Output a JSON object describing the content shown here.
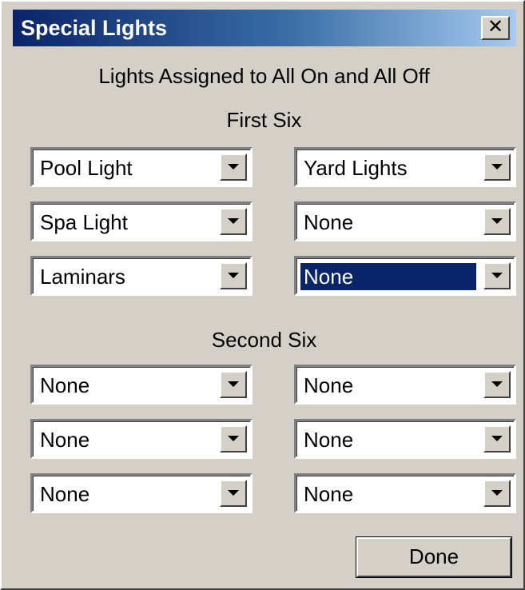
{
  "window": {
    "title": "Special Lights",
    "close_glyph": "✕"
  },
  "main": {
    "heading": "Lights Assigned to All On and All Off",
    "first_group_label": "First Six",
    "second_group_label": "Second Six",
    "first_six": [
      {
        "value": "Pool Light"
      },
      {
        "value": "Yard Lights"
      },
      {
        "value": "Spa Light"
      },
      {
        "value": "None"
      },
      {
        "value": "Laminars"
      },
      {
        "value": "None",
        "selected": true
      }
    ],
    "second_six": [
      {
        "value": "None"
      },
      {
        "value": "None"
      },
      {
        "value": "None"
      },
      {
        "value": "None"
      },
      {
        "value": "None"
      },
      {
        "value": "None"
      }
    ]
  },
  "footer": {
    "done_label": "Done"
  },
  "colors": {
    "face": "#d4d0c8",
    "title_start": "#0a246a",
    "title_end": "#a6caf0",
    "selection": "#0a246a"
  },
  "icons": {
    "close": "close-icon",
    "dropdown": "chevron-down-icon"
  }
}
